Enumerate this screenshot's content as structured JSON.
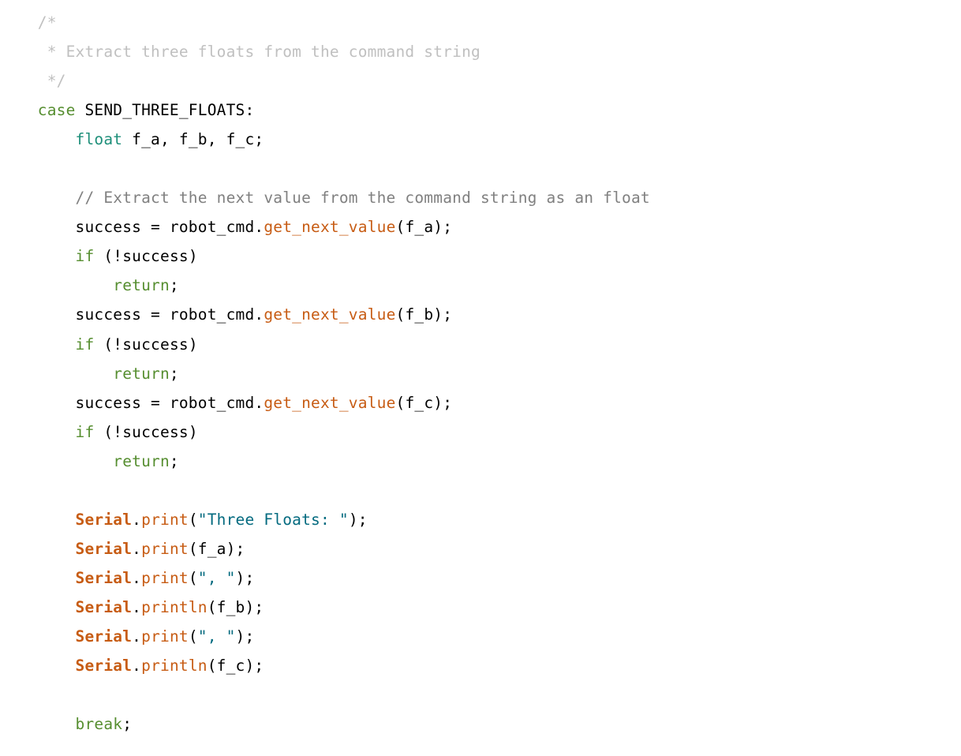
{
  "tokens": [
    [
      [
        "    ",
        ""
      ],
      [
        "/*",
        "light-comment"
      ]
    ],
    [
      [
        "     ",
        ""
      ],
      [
        "* Extract three floats from the command string",
        "light-comment"
      ]
    ],
    [
      [
        "     ",
        ""
      ],
      [
        "*/",
        "light-comment"
      ]
    ],
    [
      [
        "    ",
        ""
      ],
      [
        "case",
        "keyword"
      ],
      [
        " SEND_THREE_FLOATS:",
        "black"
      ]
    ],
    [
      [
        "        ",
        ""
      ],
      [
        "float",
        "type"
      ],
      [
        " f_a, f_b, f_c;",
        "black"
      ]
    ],
    [],
    [
      [
        "        ",
        ""
      ],
      [
        "// Extract the next value from the command string as an float",
        "dark-comment"
      ]
    ],
    [
      [
        "        ",
        ""
      ],
      [
        "success = robot_cmd.",
        "black"
      ],
      [
        "get_next_value",
        "member"
      ],
      [
        "(f_a);",
        "black"
      ]
    ],
    [
      [
        "        ",
        ""
      ],
      [
        "if",
        "keyword"
      ],
      [
        " (!success)",
        "black"
      ]
    ],
    [
      [
        "            ",
        ""
      ],
      [
        "return",
        "keyword"
      ],
      [
        ";",
        "black"
      ]
    ],
    [
      [
        "        ",
        ""
      ],
      [
        "success = robot_cmd.",
        "black"
      ],
      [
        "get_next_value",
        "member"
      ],
      [
        "(f_b);",
        "black"
      ]
    ],
    [
      [
        "        ",
        ""
      ],
      [
        "if",
        "keyword"
      ],
      [
        " (!success)",
        "black"
      ]
    ],
    [
      [
        "            ",
        ""
      ],
      [
        "return",
        "keyword"
      ],
      [
        ";",
        "black"
      ]
    ],
    [
      [
        "        ",
        ""
      ],
      [
        "success = robot_cmd.",
        "black"
      ],
      [
        "get_next_value",
        "member"
      ],
      [
        "(f_c);",
        "black"
      ]
    ],
    [
      [
        "        ",
        ""
      ],
      [
        "if",
        "keyword"
      ],
      [
        " (!success)",
        "black"
      ]
    ],
    [
      [
        "            ",
        ""
      ],
      [
        "return",
        "keyword"
      ],
      [
        ";",
        "black"
      ]
    ],
    [],
    [
      [
        "        ",
        ""
      ],
      [
        "Serial",
        "serial"
      ],
      [
        ".",
        "black"
      ],
      [
        "print",
        "member"
      ],
      [
        "(",
        "black"
      ],
      [
        "\"Three Floats: \"",
        "string"
      ],
      [
        ");",
        "black"
      ]
    ],
    [
      [
        "        ",
        ""
      ],
      [
        "Serial",
        "serial"
      ],
      [
        ".",
        "black"
      ],
      [
        "print",
        "member"
      ],
      [
        "(f_a);",
        "black"
      ]
    ],
    [
      [
        "        ",
        ""
      ],
      [
        "Serial",
        "serial"
      ],
      [
        ".",
        "black"
      ],
      [
        "print",
        "member"
      ],
      [
        "(",
        "black"
      ],
      [
        "\", \"",
        "string"
      ],
      [
        ");",
        "black"
      ]
    ],
    [
      [
        "        ",
        ""
      ],
      [
        "Serial",
        "serial"
      ],
      [
        ".",
        "black"
      ],
      [
        "println",
        "member"
      ],
      [
        "(f_b);",
        "black"
      ]
    ],
    [
      [
        "        ",
        ""
      ],
      [
        "Serial",
        "serial"
      ],
      [
        ".",
        "black"
      ],
      [
        "print",
        "member"
      ],
      [
        "(",
        "black"
      ],
      [
        "\", \"",
        "string"
      ],
      [
        ");",
        "black"
      ]
    ],
    [
      [
        "        ",
        ""
      ],
      [
        "Serial",
        "serial"
      ],
      [
        ".",
        "black"
      ],
      [
        "println",
        "member"
      ],
      [
        "(f_c);",
        "black"
      ]
    ],
    [],
    [
      [
        "        ",
        ""
      ],
      [
        "break",
        "keyword"
      ],
      [
        ";",
        "black"
      ]
    ]
  ]
}
